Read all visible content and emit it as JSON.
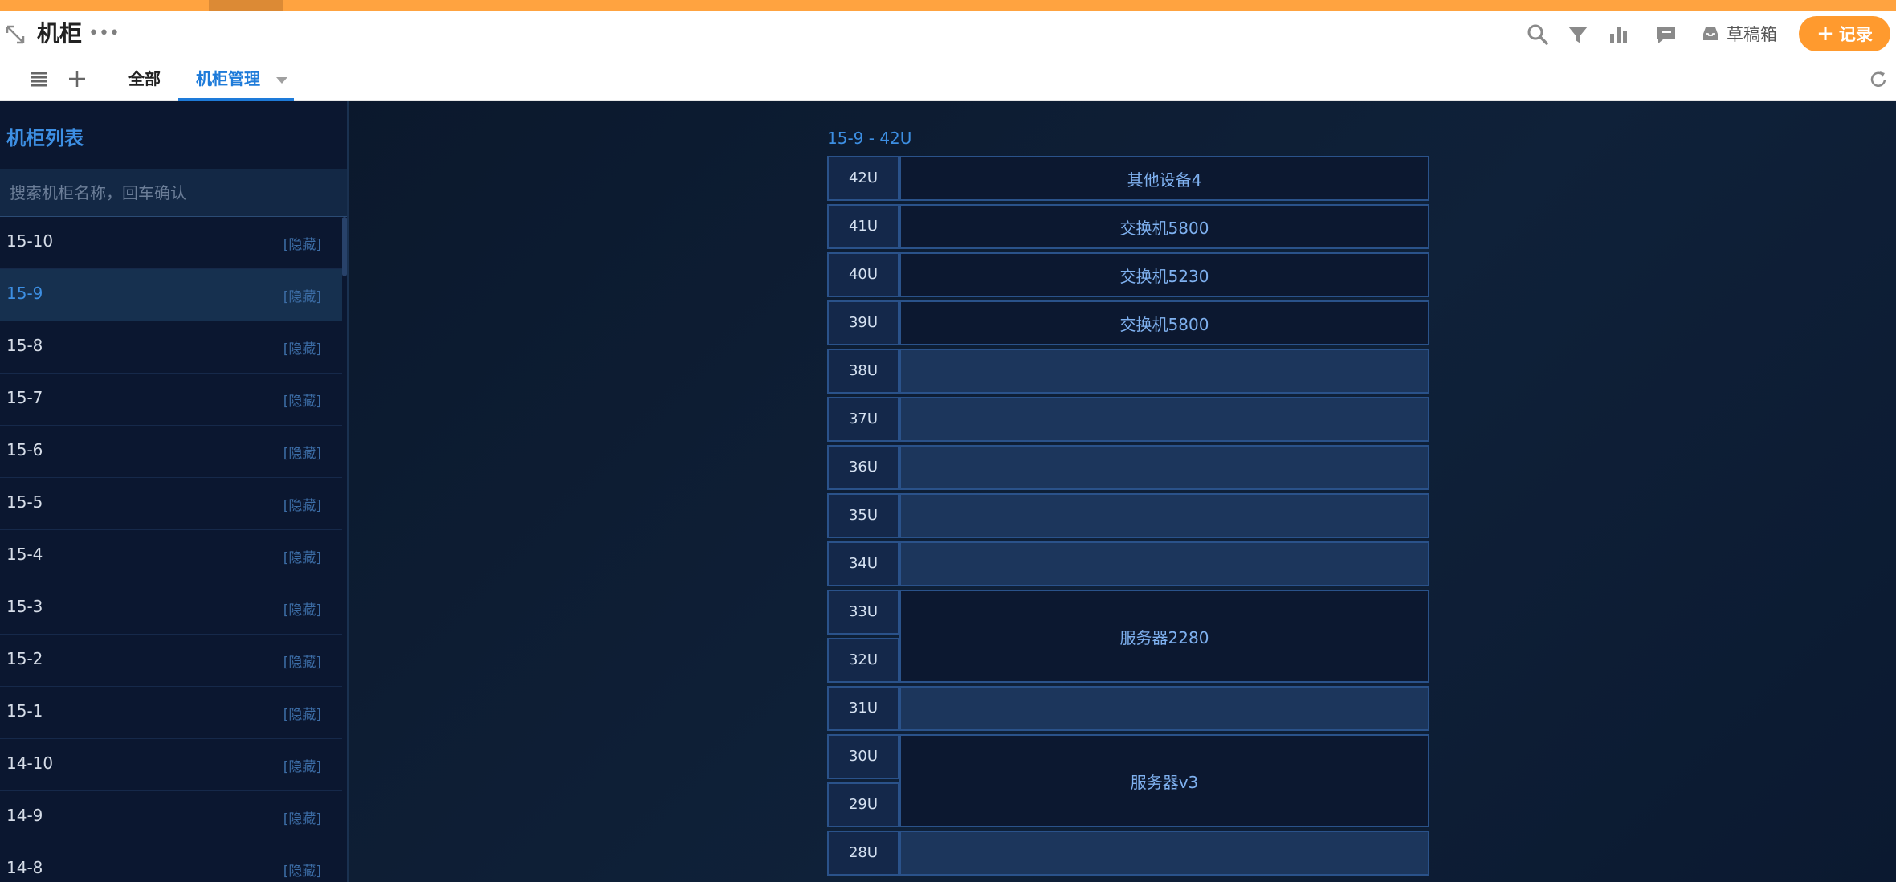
{
  "header": {
    "title": "机柜",
    "draft_label": "草稿箱",
    "record_label": "记录",
    "tabs": [
      {
        "label": "全部",
        "active": false
      },
      {
        "label": "机柜管理",
        "active": true
      }
    ],
    "accent_color": "#ffa340",
    "tab_active_color": "#1e7bd9"
  },
  "sidebar": {
    "title": "机柜列表",
    "search_placeholder": "搜索机柜名称，回车确认",
    "selected": "15-9",
    "items": [
      {
        "name": "15-10",
        "tag": "[隐藏]"
      },
      {
        "name": "15-9",
        "tag": "[隐藏]"
      },
      {
        "name": "15-8",
        "tag": "[隐藏]"
      },
      {
        "name": "15-7",
        "tag": "[隐藏]"
      },
      {
        "name": "15-6",
        "tag": "[隐藏]"
      },
      {
        "name": "15-5",
        "tag": "[隐藏]"
      },
      {
        "name": "15-4",
        "tag": "[隐藏]"
      },
      {
        "name": "15-3",
        "tag": "[隐藏]"
      },
      {
        "name": "15-2",
        "tag": "[隐藏]"
      },
      {
        "name": "15-1",
        "tag": "[隐藏]"
      },
      {
        "name": "14-10",
        "tag": "[隐藏]"
      },
      {
        "name": "14-9",
        "tag": "[隐藏]"
      },
      {
        "name": "14-8",
        "tag": "[隐藏]"
      }
    ]
  },
  "rack": {
    "caption": "15-9 - 42U",
    "units": [
      "42U",
      "41U",
      "40U",
      "39U",
      "38U",
      "37U",
      "36U",
      "35U",
      "34U",
      "33U",
      "32U",
      "31U",
      "30U",
      "29U",
      "28U"
    ],
    "devices": [
      {
        "label": "其他设备4",
        "top_unit": 42,
        "span": 1
      },
      {
        "label": "交换机5800",
        "top_unit": 41,
        "span": 1
      },
      {
        "label": "交换机5230",
        "top_unit": 40,
        "span": 1
      },
      {
        "label": "交换机5800",
        "top_unit": 39,
        "span": 1
      },
      {
        "label": "",
        "top_unit": 38,
        "span": 1
      },
      {
        "label": "",
        "top_unit": 37,
        "span": 1
      },
      {
        "label": "",
        "top_unit": 36,
        "span": 1
      },
      {
        "label": "",
        "top_unit": 35,
        "span": 1
      },
      {
        "label": "",
        "top_unit": 34,
        "span": 1
      },
      {
        "label": "服务器2280",
        "top_unit": 33,
        "span": 2
      },
      {
        "label": "",
        "top_unit": 31,
        "span": 1
      },
      {
        "label": "服务器v3",
        "top_unit": 30,
        "span": 2
      },
      {
        "label": "",
        "top_unit": 28,
        "span": 1
      }
    ]
  }
}
